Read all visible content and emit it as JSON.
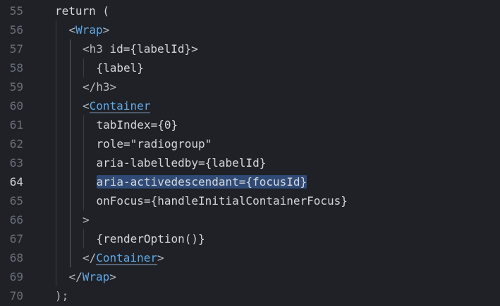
{
  "editor": {
    "current_line": 64,
    "lines": [
      {
        "num": "55",
        "indent": 1,
        "tokens": [
          {
            "t": "return (",
            "c": "keyword"
          }
        ]
      },
      {
        "num": "56",
        "indent": 2,
        "tokens": [
          {
            "t": "<",
            "c": "punct"
          },
          {
            "t": "Wrap",
            "c": "tag"
          },
          {
            "t": ">",
            "c": "punct"
          }
        ]
      },
      {
        "num": "57",
        "indent": 3,
        "tokens": [
          {
            "t": "<h3 ",
            "c": "punct"
          },
          {
            "t": "id",
            "c": "attr"
          },
          {
            "t": "={labelId}>",
            "c": "expr"
          }
        ]
      },
      {
        "num": "58",
        "indent": 4,
        "tokens": [
          {
            "t": "{label}",
            "c": "expr"
          }
        ]
      },
      {
        "num": "59",
        "indent": 3,
        "tokens": [
          {
            "t": "</h3>",
            "c": "punct"
          }
        ]
      },
      {
        "num": "60",
        "indent": 3,
        "tokens": [
          {
            "t": "<",
            "c": "punct"
          },
          {
            "t": "Container",
            "c": "tag",
            "underline": true
          }
        ]
      },
      {
        "num": "61",
        "indent": 4,
        "tokens": [
          {
            "t": "tabIndex",
            "c": "attr"
          },
          {
            "t": "={0}",
            "c": "expr"
          }
        ]
      },
      {
        "num": "62",
        "indent": 4,
        "tokens": [
          {
            "t": "role",
            "c": "attr"
          },
          {
            "t": "=\"radiogroup\"",
            "c": "string"
          }
        ]
      },
      {
        "num": "63",
        "indent": 4,
        "tokens": [
          {
            "t": "aria-labelledby",
            "c": "attr"
          },
          {
            "t": "={labelId}",
            "c": "expr"
          }
        ]
      },
      {
        "num": "64",
        "indent": 4,
        "tokens": [
          {
            "t": "aria-activedescendant={focusId}",
            "c": "attr",
            "selected": true
          }
        ]
      },
      {
        "num": "65",
        "indent": 4,
        "tokens": [
          {
            "t": "onFocus",
            "c": "attr"
          },
          {
            "t": "={handleInitialContainerFocus}",
            "c": "expr"
          }
        ]
      },
      {
        "num": "66",
        "indent": 3,
        "tokens": [
          {
            "t": ">",
            "c": "punct"
          }
        ]
      },
      {
        "num": "67",
        "indent": 4,
        "tokens": [
          {
            "t": "{renderOption()}",
            "c": "expr"
          }
        ]
      },
      {
        "num": "68",
        "indent": 3,
        "tokens": [
          {
            "t": "</",
            "c": "punct"
          },
          {
            "t": "Container",
            "c": "tag",
            "underline": true
          },
          {
            "t": ">",
            "c": "punct"
          }
        ]
      },
      {
        "num": "69",
        "indent": 2,
        "tokens": [
          {
            "t": "</",
            "c": "punct"
          },
          {
            "t": "Wrap",
            "c": "tag"
          },
          {
            "t": ">",
            "c": "punct"
          }
        ]
      },
      {
        "num": "70",
        "indent": 1,
        "tokens": [
          {
            "t": ");",
            "c": "punct"
          }
        ]
      }
    ]
  },
  "colors": {
    "background": "#1f2126",
    "tag": "#5fa8e6",
    "selection": "#2f4a75",
    "line_number": "#6a6f79",
    "line_number_current": "#cfd2d8"
  }
}
